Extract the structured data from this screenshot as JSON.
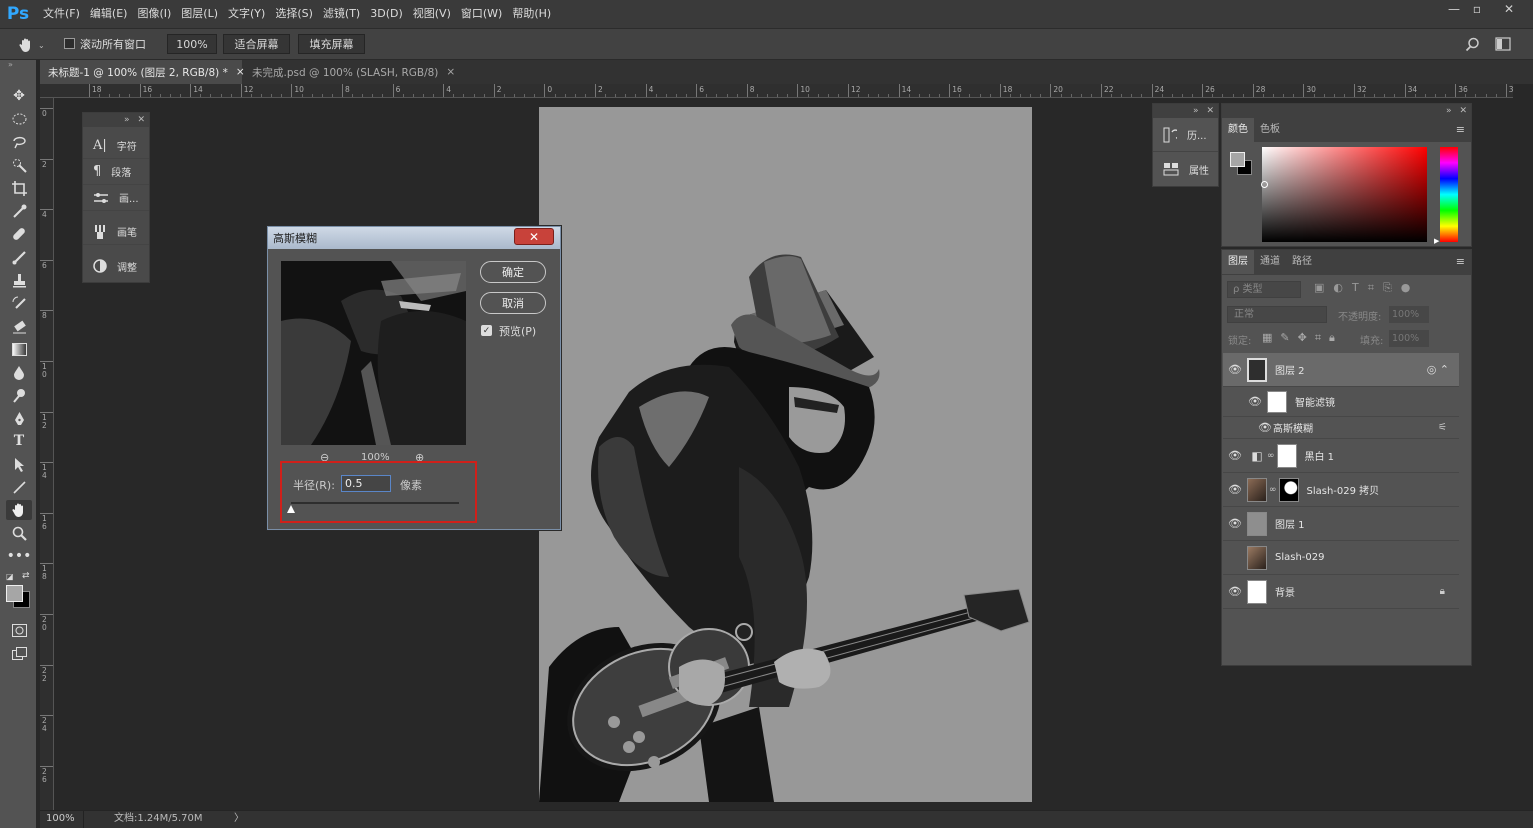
{
  "app": {
    "logo": "Ps"
  },
  "menu": [
    "文件(F)",
    "编辑(E)",
    "图像(I)",
    "图层(L)",
    "文字(Y)",
    "选择(S)",
    "滤镜(T)",
    "3D(D)",
    "视图(V)",
    "窗口(W)",
    "帮助(H)"
  ],
  "window_controls": {
    "minimize": "—",
    "maximize": "▫",
    "close": "✕"
  },
  "options": {
    "scroll_all_label": "滚动所有窗口",
    "zoom_value": "100%",
    "fit_screen_label": "适合屏幕",
    "fill_screen_label": "填充屏幕"
  },
  "tabs": [
    {
      "label": "未标题-1 @ 100% (图层 2, RGB/8) *",
      "close": "×",
      "active": true
    },
    {
      "label": "未完成.psd @ 100% (SLASH, RGB/8)",
      "close": "×",
      "active": false
    }
  ],
  "ruler_h": [
    "18",
    "16",
    "14",
    "12",
    "10",
    "8",
    "6",
    "4",
    "2",
    "0",
    "2",
    "4",
    "6",
    "8",
    "10",
    "12",
    "14",
    "16",
    "18",
    "20",
    "22",
    "24",
    "26",
    "28",
    "30",
    "32",
    "34",
    "36",
    "38"
  ],
  "ruler_v": [
    "0",
    "2",
    "4",
    "6",
    "8",
    "1 0",
    "1 2",
    "1 4",
    "1 6",
    "1 8",
    "2 0",
    "2 2",
    "2 4",
    "2 6"
  ],
  "mini_panel": {
    "items": [
      {
        "icon": "character-icon",
        "label": "字符"
      },
      {
        "icon": "paragraph-icon",
        "label": "段落"
      },
      {
        "icon": "brush-settings-icon",
        "label": "画..."
      },
      {
        "icon": "brush-icon",
        "label": "画笔"
      },
      {
        "icon": "adjustments-icon",
        "label": "调整"
      }
    ]
  },
  "history_panel": {
    "items": [
      {
        "icon": "history-icon",
        "label": "历..."
      },
      {
        "icon": "properties-icon",
        "label": "属性"
      }
    ]
  },
  "color_panel": {
    "tabs": [
      "颜色",
      "色板"
    ],
    "colors": {
      "foreground": "#a6a6a6",
      "background": "#000000",
      "hue": "#ff0000"
    }
  },
  "layers_panel": {
    "tabs": [
      "图层",
      "通道",
      "路径"
    ],
    "filter_placeholder": "ρ 类型",
    "blend_mode": "正常",
    "opacity_label": "不透明度:",
    "opacity_value": "100%",
    "lock_label": "锁定:",
    "fill_label": "填充:",
    "fill_value": "100%",
    "layers": [
      {
        "name": "图层 2",
        "visible": true,
        "selected": true
      },
      {
        "name": "智能滤镜",
        "visible": true,
        "sub": 1
      },
      {
        "name": "高斯模糊",
        "visible": true,
        "sub": 2
      },
      {
        "name": "黑白 1",
        "visible": true
      },
      {
        "name": "Slash-029 拷贝",
        "visible": true
      },
      {
        "name": "图层 1",
        "visible": true
      },
      {
        "name": "Slash-029",
        "visible": false
      },
      {
        "name": "背景",
        "visible": true,
        "locked": true
      }
    ]
  },
  "dialog": {
    "title": "高斯模糊",
    "ok_label": "确定",
    "cancel_label": "取消",
    "preview_label": "预览(P)",
    "preview_checked": true,
    "zoom_label": "100%",
    "radius_label": "半径(R):",
    "radius_value": "0.5",
    "unit_label": "像素"
  },
  "status": {
    "zoom": "100%",
    "doc_info": "文档:1.24M/5.70M",
    "arrow": "〉"
  }
}
